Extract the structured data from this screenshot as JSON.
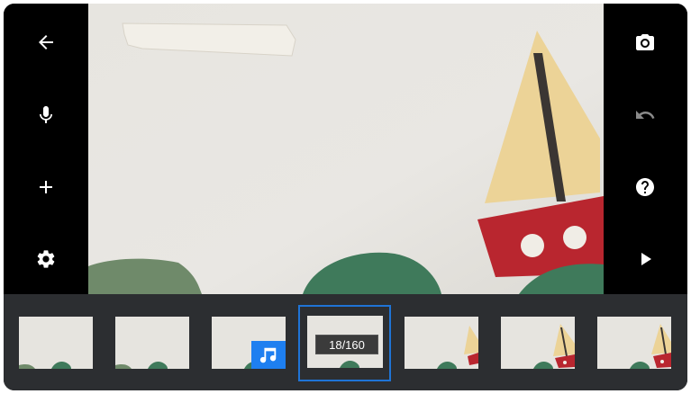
{
  "left_toolbar": {
    "back_icon": "arrow-left-icon",
    "mic_icon": "microphone-icon",
    "add_icon": "plus-icon",
    "settings_icon": "gear-icon"
  },
  "right_toolbar": {
    "camera_icon": "camera-icon",
    "undo_icon": "undo-icon",
    "help_icon": "help-icon",
    "play_icon": "play-icon"
  },
  "colors": {
    "toolbar_bg": "#000000",
    "filmstrip_bg": "#2c2e31",
    "selection": "#1f74d6",
    "music_badge": "#1e7ff0",
    "icon_active": "#ffffff",
    "icon_disabled": "#8a8a8a"
  },
  "filmstrip": {
    "frame_counter": "18/160",
    "music_icon": "music-note-icon",
    "selected_index": 3
  }
}
